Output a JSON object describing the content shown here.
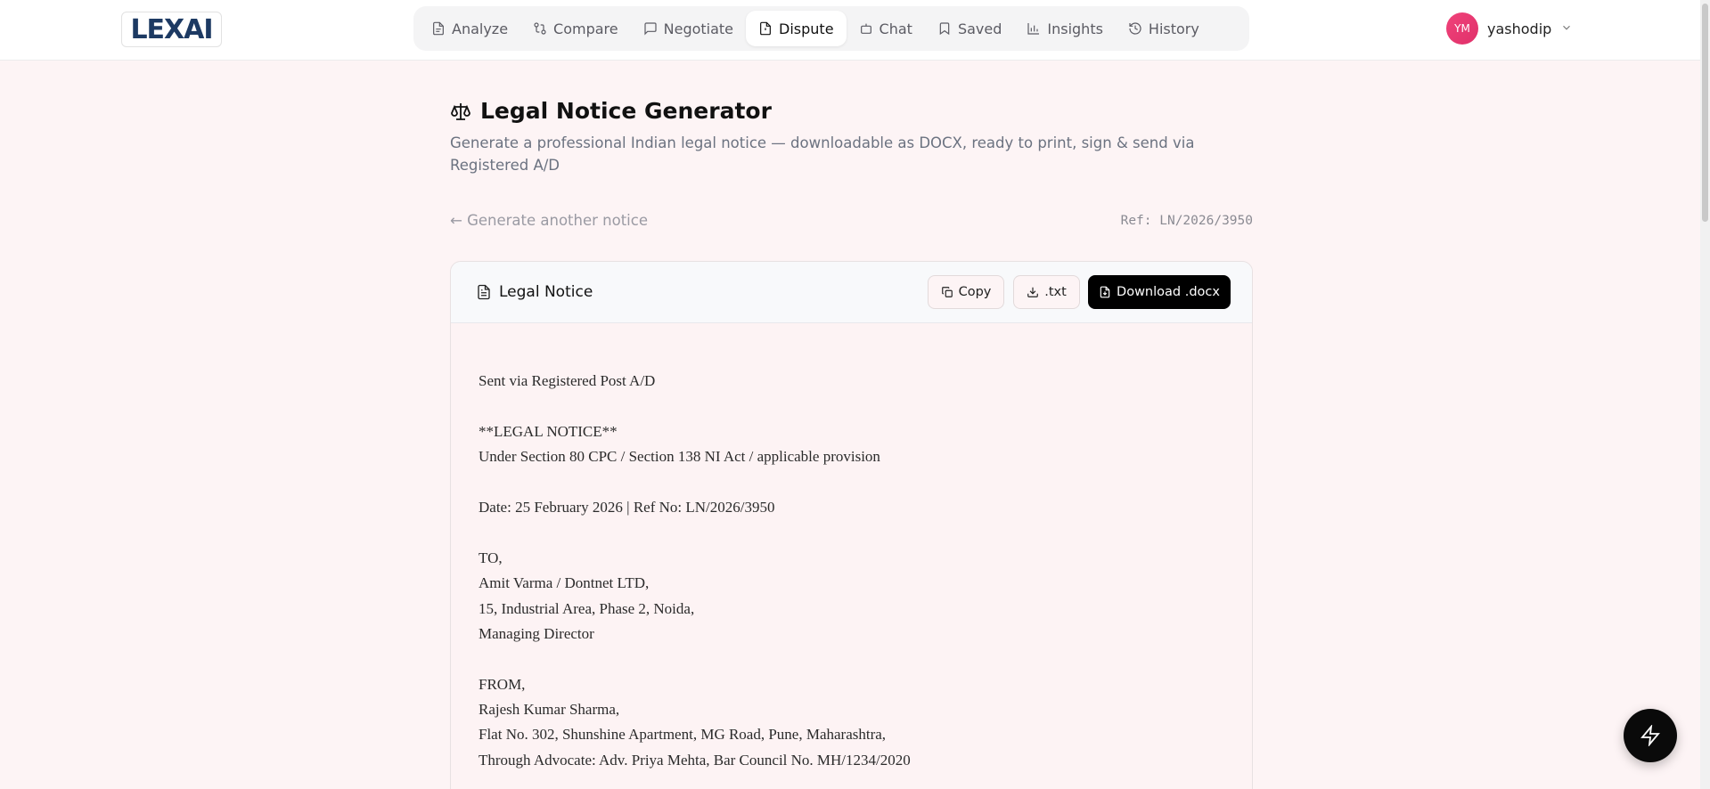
{
  "header": {
    "logo_text": "LEXAI",
    "nav": [
      {
        "label": "Analyze",
        "icon": "file-icon"
      },
      {
        "label": "Compare",
        "icon": "compare-icon"
      },
      {
        "label": "Negotiate",
        "icon": "chat-bubble-icon"
      },
      {
        "label": "Dispute",
        "icon": "alert-file-icon",
        "active": true
      },
      {
        "label": "Chat",
        "icon": "bot-icon"
      },
      {
        "label": "Saved",
        "icon": "bookmark-icon"
      },
      {
        "label": "Insights",
        "icon": "bar-chart-icon"
      },
      {
        "label": "History",
        "icon": "history-icon"
      }
    ],
    "user": {
      "initials": "YM",
      "name": "yashodip"
    }
  },
  "page": {
    "title": "Legal Notice Generator",
    "subtitle": "Generate a professional Indian legal notice — downloadable as DOCX, ready to print, sign & send via Registered A/D",
    "back_link": "← Generate another notice",
    "ref": "Ref: LN/2026/3950"
  },
  "card": {
    "title": "Legal Notice",
    "copy_label": "Copy",
    "txt_label": ".txt",
    "docx_label": "Download .docx"
  },
  "notice": {
    "sent_via": "Sent via Registered Post A/D",
    "heading": "**LEGAL NOTICE**",
    "under_section": "Under Section 80 CPC / Section 138 NI Act / applicable provision",
    "date_ref": "Date: 25 February 2026 | Ref No: LN/2026/3950",
    "to_label": "TO,",
    "to_name": "Amit Varma / Dontnet LTD,",
    "to_address": "15, Industrial Area, Phase 2, Noida,",
    "to_designation": "Managing Director",
    "from_label": "FROM,",
    "from_name": "Rajesh Kumar Sharma,",
    "from_address": "Flat No. 302, Shunshine Apartment, MG Road, Pune, Maharashtra,",
    "from_advocate": "Through Advocate: Adv. Priya Mehta, Bar Council No. MH/1234/2020"
  },
  "colors": {
    "page_bg": "#fdf4f5",
    "avatar": "#f0437a",
    "primary_button": "#000000"
  }
}
